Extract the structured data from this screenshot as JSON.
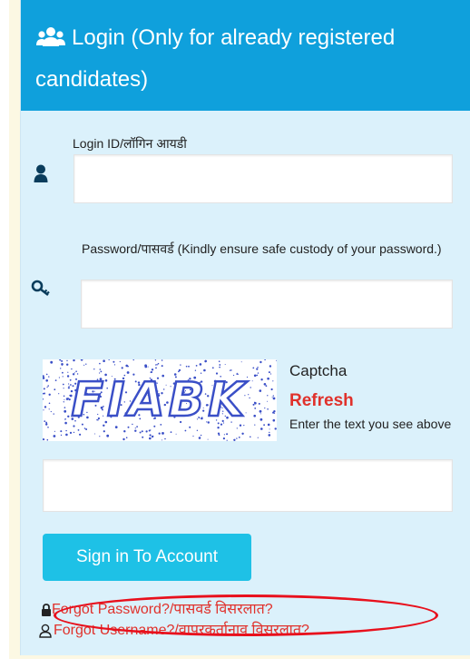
{
  "header": {
    "title": "Login (Only for already registered candidates)",
    "icon": "users-icon"
  },
  "login_field": {
    "label": "Login ID/लॉगिन आयडी",
    "value": "",
    "icon": "user-icon"
  },
  "password_field": {
    "label": "Password/पासवर्ड (Kindly ensure safe custody of your password.)",
    "value": "",
    "icon": "key-icon"
  },
  "captcha": {
    "image_text": "FIABK",
    "label": "Captcha",
    "refresh": "Refresh",
    "hint": "Enter the text you see above",
    "value": ""
  },
  "signin_button": {
    "label": "Sign in To Account"
  },
  "links": {
    "forgot_password": "Forgot Password?/पासवर्ड विसरलात?",
    "forgot_password_icon": "lock-icon",
    "forgot_username": "Forgot Username?/वापरकर्तानाव विसरलात?",
    "forgot_username_icon": "user-outline-icon"
  },
  "colors": {
    "header_bg": "#0fa0dc",
    "card_bg": "#dbf1fb",
    "button_bg": "#1ec1e6",
    "refresh": "#e0312b",
    "link": "#e0312b",
    "annotation_ellipse": "#e8101c"
  }
}
